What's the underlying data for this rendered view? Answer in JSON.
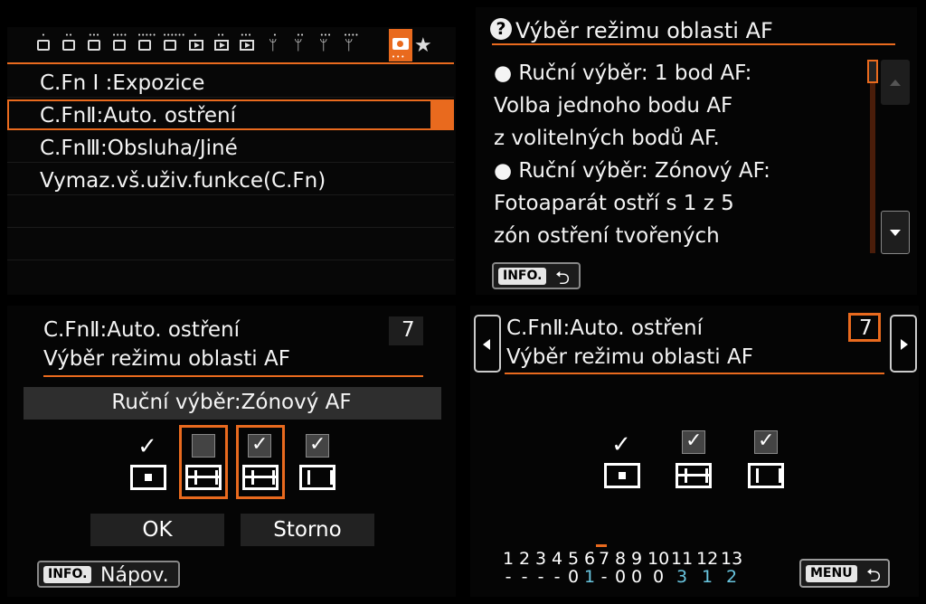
{
  "colors": {
    "accent": "#e96a1e",
    "highlight": "#69c6e0",
    "background": "#000000"
  },
  "top_left": {
    "tabs": [
      "shoot-1",
      "shoot-2",
      "shoot-3",
      "shoot-4",
      "shoot-5",
      "shoot-6",
      "play-1",
      "play-2",
      "play-3",
      "setup-1",
      "setup-2",
      "setup-3",
      "setup-4",
      "custom-functions",
      "my-menu"
    ],
    "tab_dots": [
      "•",
      "••",
      "•••",
      "••••",
      "•••••",
      "••••••",
      "•",
      "••",
      "•••",
      "•",
      "••",
      "•••",
      "••••",
      "•••",
      "★"
    ],
    "items": [
      {
        "label": "C.Fn Ⅰ :Expozice"
      },
      {
        "label": "C.FnⅡ:Auto. ostření"
      },
      {
        "label": "C.FnⅢ:Obsluha/Jiné"
      },
      {
        "label": "Vymaz.vš.uživ.funkce(C.Fn)"
      }
    ],
    "selected_index": 1
  },
  "top_right": {
    "title": "Výběr režimu oblasti AF",
    "help_lines": [
      "● Ruční výběr: 1 bod AF:",
      "Volba jednoho bodu AF",
      "z volitelných bodů AF.",
      "● Ruční výběr: Zónový AF:",
      "Fotoaparát ostří s 1 z 5",
      "zón ostření tvořených"
    ],
    "info_label": "INFO."
  },
  "bottom_left": {
    "header": "C.FnⅡ:Auto. ostření",
    "number": "7",
    "subtitle": "Výběr režimu oblasti AF",
    "selection_label": "Ruční výběr:Zónový AF",
    "options": [
      {
        "name": "single-point",
        "checked": true
      },
      {
        "name": "zone",
        "checked": false
      },
      {
        "name": "zone",
        "checked": true
      },
      {
        "name": "wide",
        "checked": true
      }
    ],
    "ok_label": "OK",
    "cancel_label": "Storno",
    "info_label": "INFO.",
    "help_label": "Nápov."
  },
  "bottom_right": {
    "header": "C.FnⅡ:Auto. ostření",
    "number": "7",
    "subtitle": "Výběr režimu oblasti AF",
    "check_mark": "✓",
    "options": [
      {
        "name": "single-point",
        "checked": true
      },
      {
        "name": "zone",
        "checked": true
      },
      {
        "name": "wide",
        "checked": true
      }
    ],
    "function_numbers": [
      "1",
      "2",
      "3",
      "4",
      "5",
      "6",
      "7",
      "8",
      "9",
      "10",
      "11",
      "12",
      "13"
    ],
    "function_values": [
      "-",
      "-",
      "-",
      "-",
      "0",
      "1",
      "-",
      "0",
      "0",
      "0",
      "3",
      "1",
      "2"
    ],
    "current_function": "7",
    "menu_label": "MENU"
  }
}
